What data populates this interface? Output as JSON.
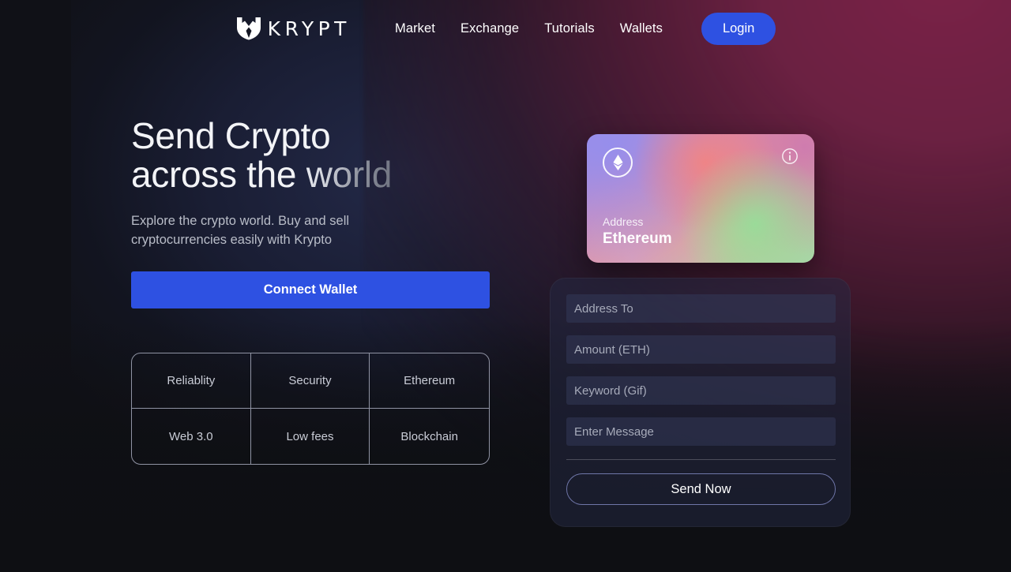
{
  "navbar": {
    "logo_icon": "krypt-shield-logo-icon",
    "brand": "KRYPT",
    "links": [
      {
        "label": "Market"
      },
      {
        "label": "Exchange"
      },
      {
        "label": "Tutorials"
      },
      {
        "label": "Wallets"
      }
    ],
    "login_label": "Login"
  },
  "hero": {
    "title_line1": "Send Crypto",
    "title_line2_plain": "across the ",
    "title_line2_accent": "world",
    "subtitle_line1": "Explore the crypto world. Buy and sell",
    "subtitle_line2": "cryptocurrencies easily with Krypto",
    "connect_label": "Connect Wallet"
  },
  "features": [
    {
      "label": "Reliablity"
    },
    {
      "label": "Security"
    },
    {
      "label": "Ethereum"
    },
    {
      "label": "Web 3.0"
    },
    {
      "label": "Low fees"
    },
    {
      "label": "Blockchain"
    }
  ],
  "eth_card": {
    "coin_icon": "ethereum-icon",
    "info_icon": "info-icon",
    "address_label": "Address",
    "network_name": "Ethereum"
  },
  "form": {
    "address_to_placeholder": "Address To",
    "address_to_value": "",
    "amount_placeholder": "Amount (ETH)",
    "amount_value": "",
    "keyword_placeholder": "Keyword (Gif)",
    "keyword_value": "",
    "message_placeholder": "Enter Message",
    "message_value": "",
    "send_label": "Send Now"
  },
  "colors": {
    "accent_blue": "#2e51e2",
    "background_dark": "#101117",
    "glow_maroon": "#6b2142",
    "glow_navy": "#242a4a",
    "panel": "#252944",
    "field": "#333858"
  }
}
